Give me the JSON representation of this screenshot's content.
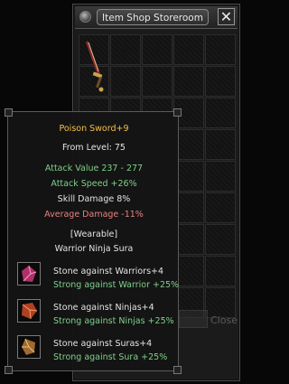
{
  "window": {
    "title": "Item Shop Storeroom",
    "close_glyph": "✕",
    "close_button_label": "Close"
  },
  "storeroom_slots": 45,
  "stored_item_icon": "poison-sword-icon",
  "tooltip": {
    "name": "Poison Sword+9",
    "from_level": "From Level: 75",
    "attack_value": "Attack Value 237 - 277",
    "attack_speed": "Attack Speed +26%",
    "skill_damage": "Skill Damage 8%",
    "average_damage": "Average Damage -11%",
    "wearable": "[Wearable]",
    "classes": "Warrior Ninja Sura",
    "stones": [
      {
        "name": "Stone against Warriors+4",
        "bonus": "Strong against Warrior +25%",
        "icon": "warrior-stone-icon"
      },
      {
        "name": "Stone against Ninjas+4",
        "bonus": "Strong against Ninjas +25%",
        "icon": "ninja-stone-icon"
      },
      {
        "name": "Stone against Suras+4",
        "bonus": "Strong against Sura +25%",
        "icon": "sura-stone-icon"
      }
    ]
  },
  "colors": {
    "item_name": "#f2c04a",
    "bonus_green": "#7fd18a",
    "negative_red": "#e88080"
  }
}
